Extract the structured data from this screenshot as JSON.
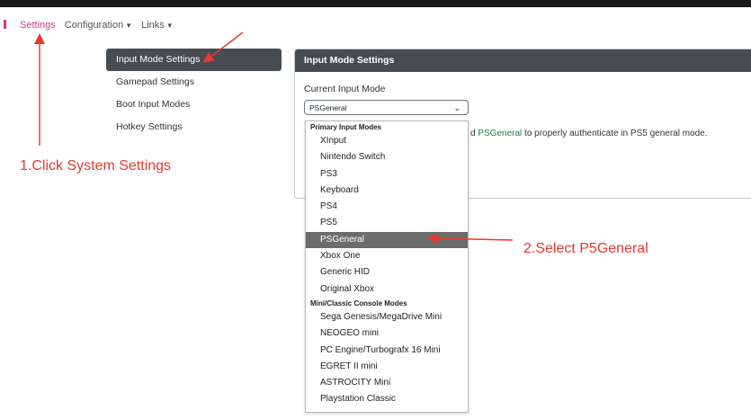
{
  "nav": {
    "settings": "Settings",
    "configuration": "Configuration",
    "links": "Links"
  },
  "sidebar": {
    "items": [
      {
        "label": "Input Mode Settings",
        "active": true
      },
      {
        "label": "Gamepad Settings"
      },
      {
        "label": "Boot Input Modes"
      },
      {
        "label": "Hotkey Settings"
      }
    ]
  },
  "card": {
    "title": "Input Mode Settings",
    "current_label": "Current Input Mode",
    "selected_value": "PSGeneral",
    "info_prefix": "d",
    "info_highlight": "PSGeneral",
    "info_suffix": "to properly authenticate in PS5 general mode."
  },
  "dropdown": {
    "group1": "Primary Input Modes",
    "group1_items": [
      "XInput",
      "Nintendo Switch",
      "PS3",
      "Keyboard",
      "PS4",
      "PS5",
      "PSGeneral",
      "Xbox One",
      "Generic HID",
      "Original Xbox"
    ],
    "group2": "Mini/Classic Console Modes",
    "group2_items": [
      "Sega Genesis/MegaDrive Mini",
      "NEOGEO mini",
      "PC Engine/Turbografx 16 Mini",
      "EGRET II mini",
      "ASTROCITY Mini",
      "Playstation Classic"
    ]
  },
  "annotations": {
    "step1": "1.Click System Settings",
    "step2": "2.Select P5General"
  },
  "colors": {
    "accent": "#d63384",
    "annotation": "#e8382d",
    "header": "#474c52"
  }
}
